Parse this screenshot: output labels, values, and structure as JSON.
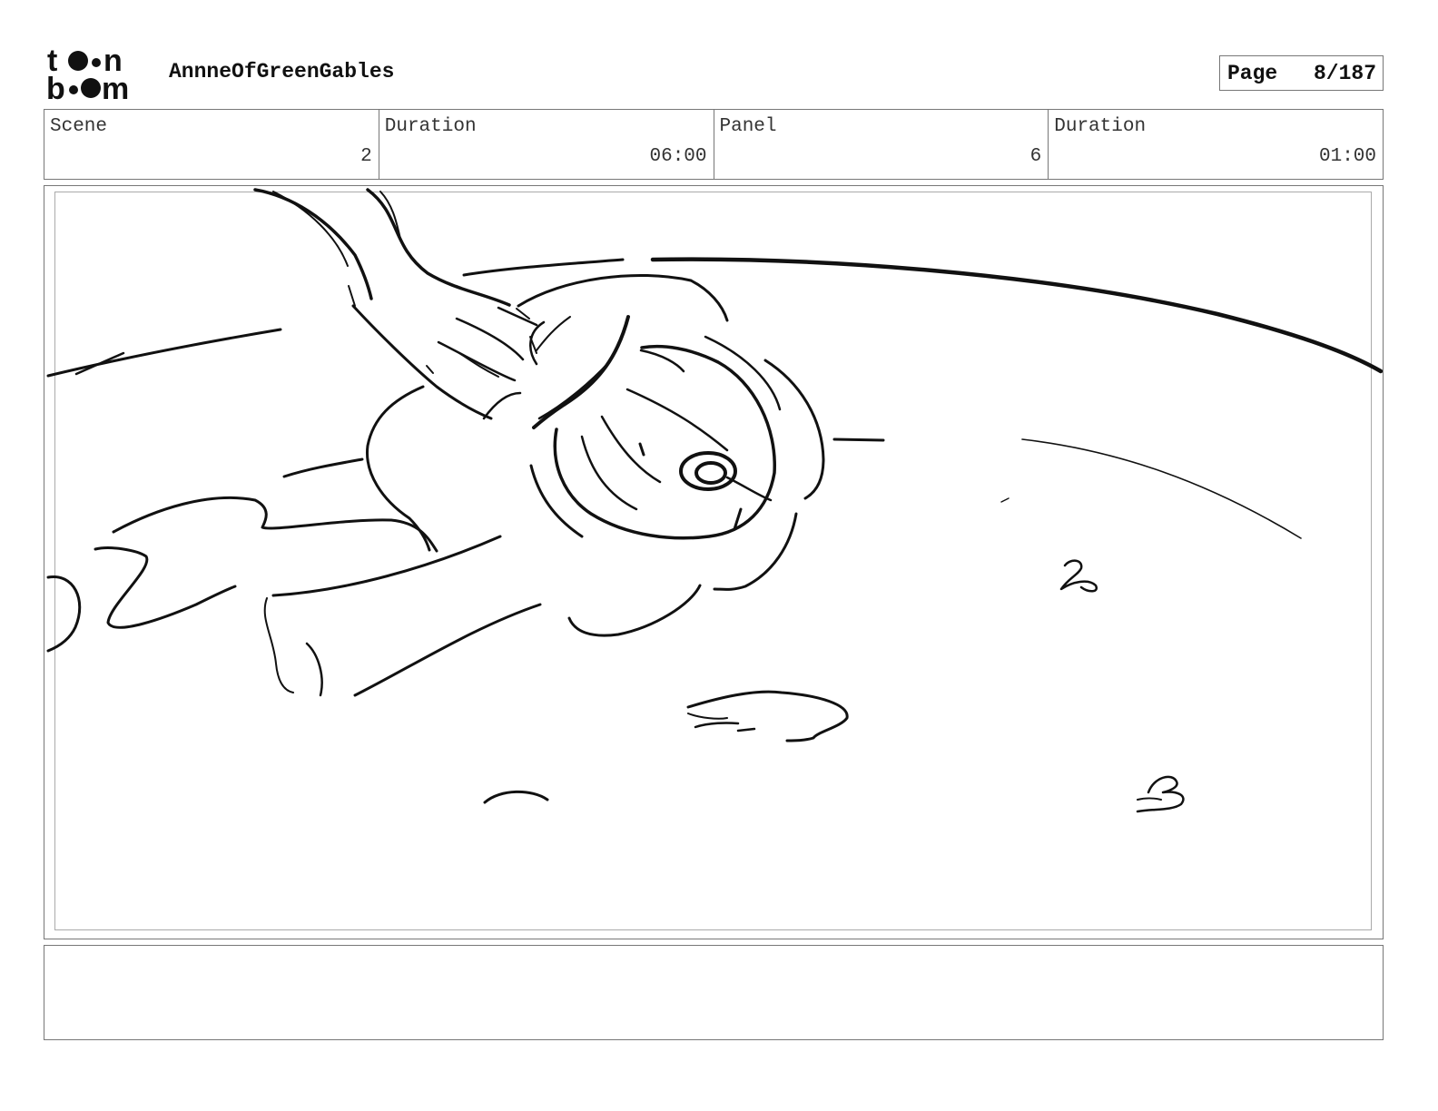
{
  "header": {
    "logo_text_top": "toon",
    "logo_text_bottom": "boom",
    "project_title": "AnnneOfGreenGables",
    "page_label": "Page",
    "page_value": "8/187"
  },
  "info": {
    "scene_label": "Scene",
    "scene_value": "2",
    "scene_duration_label": "Duration",
    "scene_duration_value": "06:00",
    "panel_label": "Panel",
    "panel_value": "6",
    "panel_duration_label": "Duration",
    "panel_duration_value": "01:00"
  },
  "notes": {
    "text": ""
  },
  "colors": {
    "ink": "#111111",
    "border": "#777777",
    "background": "#ffffff"
  }
}
